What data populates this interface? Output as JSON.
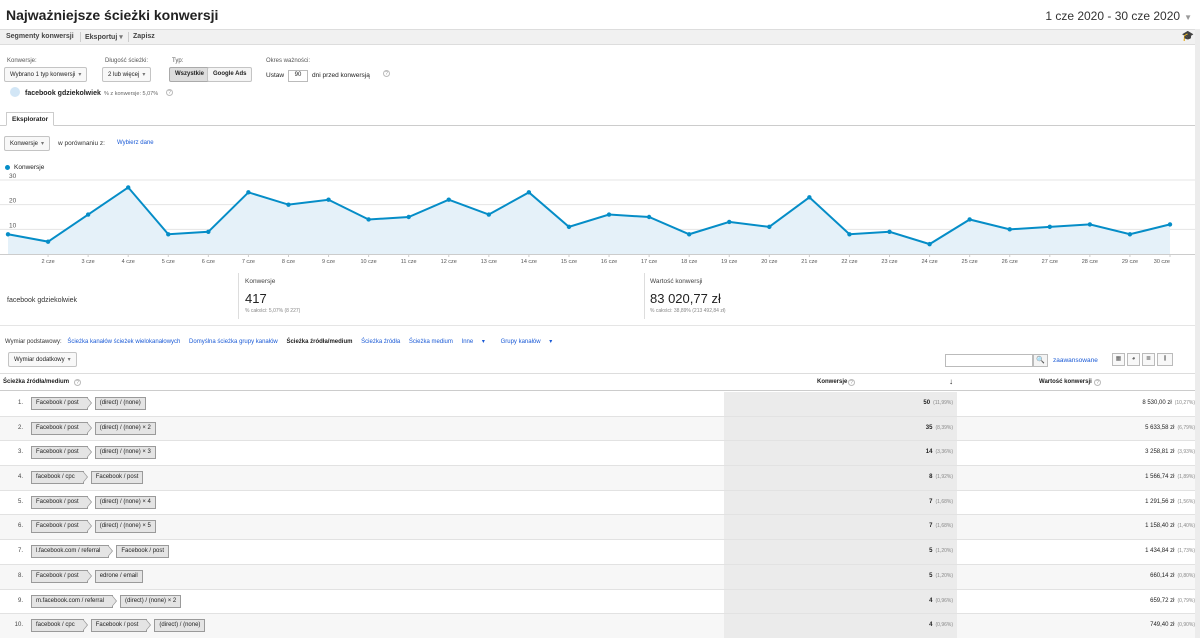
{
  "header": {
    "title": "Najważniejsze ścieżki konwersji",
    "date_range": "1 cze 2020 - 30 cze 2020"
  },
  "toolbar": {
    "segments": "Segmenty konwersji",
    "export": "Eksportuj",
    "save": "Zapisz"
  },
  "filters": {
    "conversion_label": "Konwersje:",
    "conversion_value": "Wybrano 1 typ konwersji",
    "length_label": "Długość ścieżki:",
    "length_value": "2 lub więcej",
    "type_label": "Typ:",
    "type_all": "Wszystkie",
    "type_ads": "Google Ads",
    "lookback_label": "Okres ważności:",
    "lookback_prefix": "Ustaw",
    "lookback_days": "90",
    "lookback_suffix": "dni przed konwersją"
  },
  "segment": {
    "name": "facebook gdziekolwiek",
    "share": "% z konwersje: 5,07%"
  },
  "explorer": {
    "tab": "Eksplorator",
    "metric": "Konwersje",
    "compare_label": "w porównaniu z:",
    "choose_data": "Wybierz dane"
  },
  "chart_data": {
    "type": "area",
    "series": [
      {
        "name": "Konwersje",
        "values": [
          8,
          5,
          16,
          27,
          8,
          9,
          25,
          20,
          22,
          14,
          15,
          22,
          16,
          25,
          11,
          16,
          15,
          8,
          13,
          11,
          23,
          8,
          9,
          4,
          14,
          10,
          11,
          12,
          8,
          12
        ]
      }
    ],
    "x": [
      "1 cze",
      "2 cze",
      "3 cze",
      "4 cze",
      "5 cze",
      "6 cze",
      "7 cze",
      "8 cze",
      "9 cze",
      "10 cze",
      "11 cze",
      "12 cze",
      "13 cze",
      "14 cze",
      "15 cze",
      "16 cze",
      "17 cze",
      "18 cze",
      "19 cze",
      "20 cze",
      "21 cze",
      "22 cze",
      "23 cze",
      "24 cze",
      "25 cze",
      "26 cze",
      "27 cze",
      "28 cze",
      "29 cze",
      "30 cze"
    ],
    "x_tick_labels": [
      "2 cze",
      "3 cze",
      "4 cze",
      "5 cze",
      "6 cze",
      "7 cze",
      "8 cze",
      "9 cze",
      "10 cze",
      "11 cze",
      "12 cze",
      "13 cze",
      "14 cze",
      "15 cze",
      "16 cze",
      "17 cze",
      "18 cze",
      "19 cze",
      "20 cze",
      "21 cze",
      "22 cze",
      "23 cze",
      "24 cze",
      "25 cze",
      "26 cze",
      "27 cze",
      "28 cze",
      "29 cze",
      "30 cze"
    ],
    "y_ticks": [
      10,
      20,
      30
    ],
    "ylim": [
      0,
      30
    ],
    "grid": true,
    "color": "#058dc7",
    "fill": "#e5f1f9"
  },
  "scorecards": {
    "segment": "facebook gdziekolwiek",
    "conversions": {
      "label": "Konwersje",
      "value": "417",
      "sub": "% całości: 5,07% (8 227)"
    },
    "value": {
      "label": "Wartość konwersji",
      "value": "83 020,77 zł",
      "sub": "% całości: 38,89% (213 492,84 zł)"
    }
  },
  "dimensions": {
    "label": "Wymiar podstawowy:",
    "items": [
      "Ścieżka kanałów ścieżek wielokanałowych",
      "Domyślna ścieżka grupy kanałów",
      "Ścieżka źródła/medium",
      "Ścieżka źródła",
      "Ścieżka medium",
      "Inne",
      "Grupy kanałów"
    ]
  },
  "table_controls": {
    "secondary": "Wymiar dodatkowy",
    "advanced": "zaawansowane"
  },
  "table": {
    "col_path": "Ścieżka źródła/medium",
    "col_conv": "Konwersje",
    "col_value": "Wartość konwersji",
    "rows": [
      {
        "idx": "1.",
        "chips": [
          "Facebook / post",
          "(direct) / (none)"
        ],
        "conv": "50",
        "conv_pct": "(11,99%)",
        "value": "8 530,00 zł",
        "value_pct": "(10,27%)"
      },
      {
        "idx": "2.",
        "chips": [
          "Facebook / post",
          "(direct) / (none) × 2"
        ],
        "conv": "35",
        "conv_pct": "(8,39%)",
        "value": "5 633,58 zł",
        "value_pct": "(6,79%)"
      },
      {
        "idx": "3.",
        "chips": [
          "Facebook / post",
          "(direct) / (none) × 3"
        ],
        "conv": "14",
        "conv_pct": "(3,36%)",
        "value": "3 258,81 zł",
        "value_pct": "(3,93%)"
      },
      {
        "idx": "4.",
        "chips": [
          "facebook / cpc",
          "Facebook / post"
        ],
        "conv": "8",
        "conv_pct": "(1,92%)",
        "value": "1 566,74 zł",
        "value_pct": "(1,89%)"
      },
      {
        "idx": "5.",
        "chips": [
          "Facebook / post",
          "(direct) / (none) × 4"
        ],
        "conv": "7",
        "conv_pct": "(1,68%)",
        "value": "1 291,56 zł",
        "value_pct": "(1,56%)"
      },
      {
        "idx": "6.",
        "chips": [
          "Facebook / post",
          "(direct) / (none) × 5"
        ],
        "conv": "7",
        "conv_pct": "(1,68%)",
        "value": "1 158,40 zł",
        "value_pct": "(1,40%)"
      },
      {
        "idx": "7.",
        "chips": [
          "l.facebook.com / referral",
          "Facebook / post"
        ],
        "conv": "5",
        "conv_pct": "(1,20%)",
        "value": "1 434,84 zł",
        "value_pct": "(1,73%)"
      },
      {
        "idx": "8.",
        "chips": [
          "Facebook / post",
          "edrone / email"
        ],
        "conv": "5",
        "conv_pct": "(1,20%)",
        "value": "660,14 zł",
        "value_pct": "(0,80%)"
      },
      {
        "idx": "9.",
        "chips": [
          "m.facebook.com / referral",
          "(direct) / (none) × 2"
        ],
        "conv": "4",
        "conv_pct": "(0,96%)",
        "value": "659,72 zł",
        "value_pct": "(0,79%)"
      },
      {
        "idx": "10.",
        "chips": [
          "facebook / cpc",
          "Facebook / post",
          "(direct) / (none)"
        ],
        "conv": "4",
        "conv_pct": "(0,96%)",
        "value": "749,40 zł",
        "value_pct": "(0,90%)"
      }
    ]
  }
}
